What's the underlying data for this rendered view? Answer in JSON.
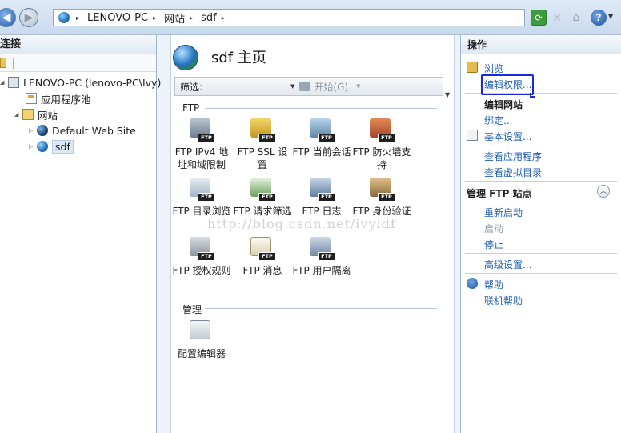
{
  "address_bar": {
    "crumbs": [
      "LENOVO-PC",
      "网站",
      "sdf"
    ],
    "separator": "▸"
  },
  "icons": {
    "back": "back-arrow-icon",
    "forward": "forward-arrow-icon",
    "refresh": "refresh-icon",
    "stop": "stop-icon",
    "home": "home-icon",
    "help": "help-icon"
  },
  "connections": {
    "title": "连接",
    "tree": [
      {
        "label": "LENOVO-PC (lenovo-PC\\Ivy)",
        "icon": "server-icon"
      },
      {
        "label": "应用程序池",
        "icon": "app-pool-icon"
      },
      {
        "label": "网站",
        "icon": "sites-folder-icon"
      },
      {
        "label": "Default Web Site",
        "icon": "site-globe-icon"
      },
      {
        "label": "sdf",
        "icon": "site-globe-icon",
        "selected": true
      }
    ]
  },
  "home": {
    "title": "sdf 主页",
    "filter_label": "筛选:",
    "filter_value": "",
    "go_label": "开始(G)",
    "groups": [
      {
        "label": "FTP",
        "features": [
          {
            "label": "FTP IPv4 地址和域限制",
            "badge": "FTP"
          },
          {
            "label": "FTP SSL 设置",
            "badge": "FTP"
          },
          {
            "label": "FTP 当前会话",
            "badge": "FTP"
          },
          {
            "label": "FTP 防火墙支持",
            "badge": "FTP"
          },
          {
            "label": "FTP 目录浏览",
            "badge": "FTP"
          },
          {
            "label": "FTP 请求筛选",
            "badge": "FTP"
          },
          {
            "label": "FTP 日志",
            "badge": "FTP"
          },
          {
            "label": "FTP 身份验证",
            "badge": "FTP"
          },
          {
            "label": "FTP 授权规则",
            "badge": "FTP"
          },
          {
            "label": "FTP 消息",
            "badge": "FTP"
          },
          {
            "label": "FTP 用户隔离",
            "badge": "FTP"
          }
        ]
      },
      {
        "label": "管理",
        "features": [
          {
            "label": "配置编辑器",
            "badge": ""
          }
        ]
      }
    ],
    "watermark": "http://blog.csdn.net/ivyldf"
  },
  "actions": {
    "title": "操作",
    "items": [
      {
        "label": "浏览",
        "style": "link"
      },
      {
        "label": "编辑权限...",
        "style": "link",
        "highlighted": true
      },
      {
        "label": "编辑网站",
        "style": "bold"
      },
      {
        "label": "绑定...",
        "style": "link"
      },
      {
        "label": "基本设置...",
        "style": "link"
      },
      {
        "label": "查看应用程序",
        "style": "link"
      },
      {
        "label": "查看虚拟目录",
        "style": "link"
      }
    ],
    "ftp_section_title": "管理 FTP 站点",
    "ftp_items": [
      {
        "label": "重新启动",
        "style": "link"
      },
      {
        "label": "启动",
        "style": "disabled"
      },
      {
        "label": "停止",
        "style": "link"
      },
      {
        "label": "高级设置...",
        "style": "link"
      }
    ],
    "help_items": [
      {
        "label": "帮助",
        "style": "link"
      },
      {
        "label": "联机帮助",
        "style": "link"
      }
    ]
  },
  "colors": {
    "link": "#1f5fb0",
    "highlight_box": "#1a2ad9",
    "panel_border": "#9db3cc"
  }
}
